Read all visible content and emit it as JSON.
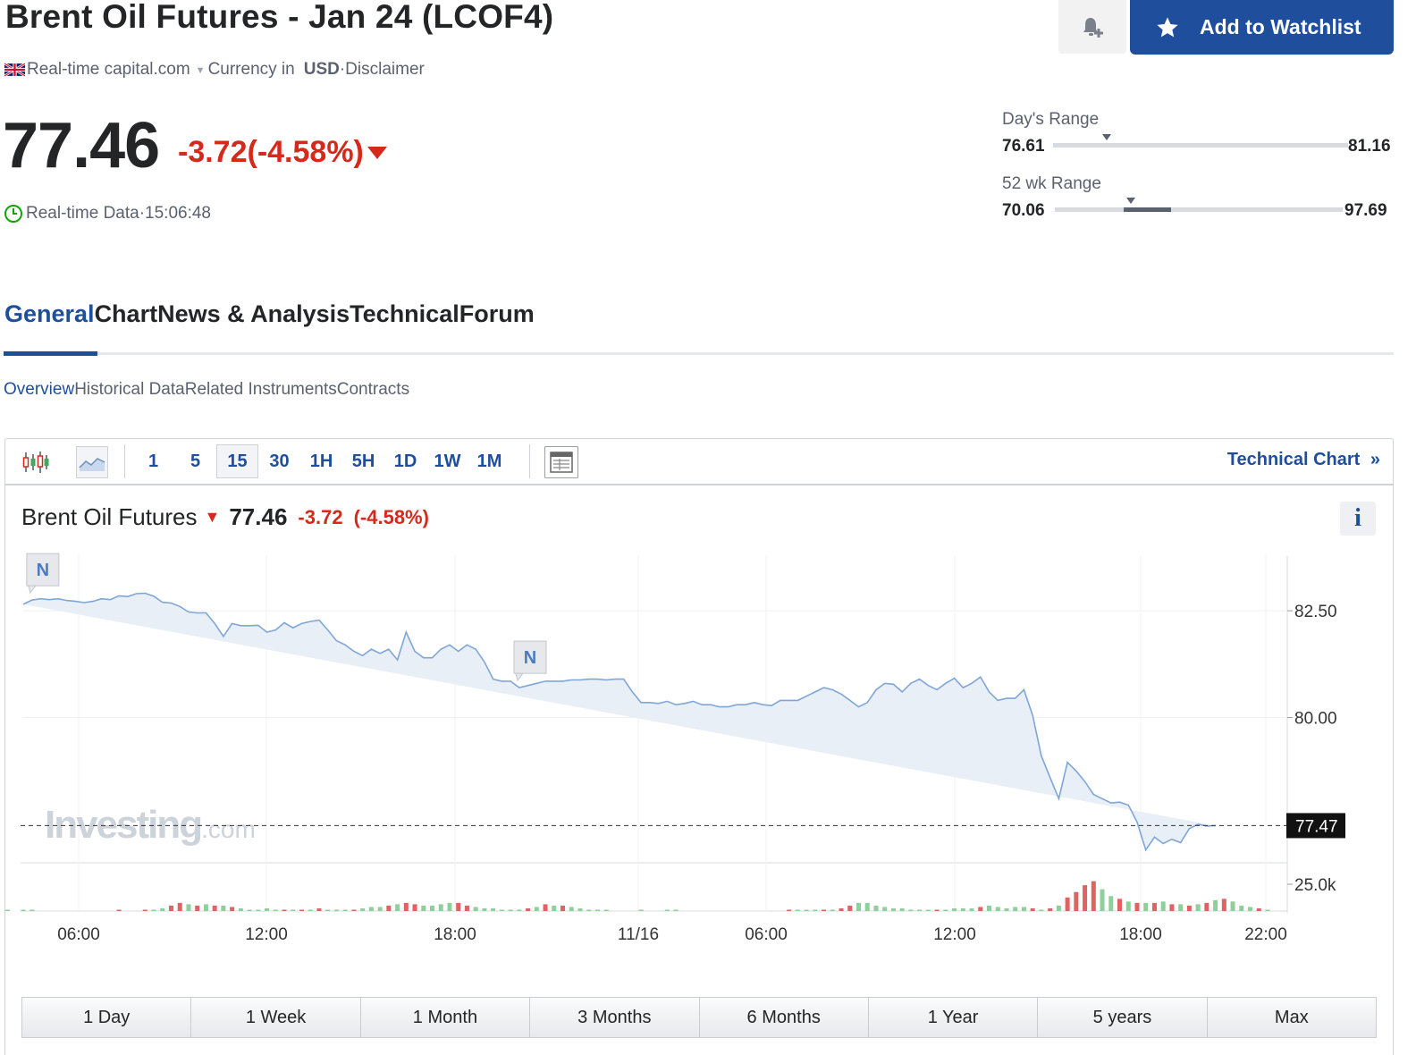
{
  "header": {
    "title": "Brent Oil Futures - Jan 24 (LCOF4)",
    "source": "Real-time capital.com",
    "currency_label": "Currency in",
    "currency": "USD",
    "disclaimer": "·Disclaimer",
    "watchlist_label": "Add to Watchlist"
  },
  "quote": {
    "price": "77.46",
    "change": "-3.72(-4.58%)",
    "realtime_label": "Real-time Data·15:06:48"
  },
  "ranges": {
    "day_label": "Day's Range",
    "day_low": "76.61",
    "day_high": "81.16",
    "wk52_label": "52 wk Range",
    "wk52_low": "70.06",
    "wk52_high": "97.69"
  },
  "tabs": [
    "General",
    "Chart",
    "News & Analysis",
    "Technical",
    "Forum"
  ],
  "subtabs": [
    "Overview",
    "Historical Data",
    "Related Instruments",
    "Contracts"
  ],
  "toolbar": {
    "intervals": [
      "1",
      "5",
      "15",
      "30",
      "1H",
      "5H",
      "1D",
      "1W",
      "1M"
    ],
    "selected_interval": "15",
    "technical_chart_label": "Technical Chart",
    "technical_chart_chevron": "»"
  },
  "chart_header": {
    "name": "Brent Oil Futures",
    "price": "77.46",
    "change": "-3.72",
    "change_pct": "(-4.58%)",
    "info": "i"
  },
  "periods": [
    "1 Day",
    "1 Week",
    "1 Month",
    "3 Months",
    "6 Months",
    "1 Year",
    "5 years",
    "Max"
  ],
  "colors": {
    "brand_blue": "#1e4e9c",
    "down_red": "#d52a1b",
    "line": "#7fa6d6",
    "area": "#e8eef7",
    "vol_up": "#8fcf9c",
    "vol_down": "#e06262"
  },
  "chart_data": {
    "type": "area",
    "watermark": "Investing.com",
    "y_ticks": [
      "82.50",
      "80.00"
    ],
    "volume_tick": "25.0k",
    "last_price_label": "77.47",
    "news_marker": "N",
    "ylim": [
      76.6,
      83.8
    ],
    "x_ticks": [
      "06:00",
      "12:00",
      "18:00",
      "11/16",
      "06:00",
      "12:00",
      "18:00",
      "22:00"
    ],
    "x": [
      0,
      2,
      4,
      6,
      8,
      10,
      12,
      14,
      16,
      18,
      20,
      22,
      24,
      26,
      28,
      30,
      32,
      34,
      36,
      38,
      40,
      42,
      44,
      46,
      48,
      50,
      52,
      54,
      56,
      58,
      60,
      62,
      64,
      66,
      68,
      70,
      72,
      74,
      76,
      78,
      80,
      82,
      84,
      86,
      88,
      90,
      92,
      94,
      96,
      98,
      100,
      102,
      104,
      106,
      108,
      110,
      112,
      114,
      116,
      118,
      120,
      122,
      124,
      126,
      128,
      130,
      132,
      134,
      136,
      138,
      140,
      142,
      144,
      146,
      148,
      150,
      152,
      154,
      156,
      158,
      160,
      162,
      164,
      166,
      168,
      170,
      172,
      174,
      176,
      178,
      180,
      182,
      184,
      186,
      188,
      190,
      192,
      194,
      196,
      198,
      200,
      202,
      204,
      206,
      208,
      210,
      212,
      214,
      216,
      218,
      220,
      222,
      224,
      226,
      228,
      230,
      232,
      234,
      236,
      238,
      240,
      242,
      244,
      246,
      248,
      250,
      252,
      254,
      256,
      258,
      260,
      262,
      264,
      266,
      268,
      270,
      272,
      274,
      276,
      278,
      280,
      282,
      284,
      286
    ],
    "values": [
      82.65,
      82.75,
      82.78,
      82.76,
      82.78,
      82.74,
      82.72,
      82.69,
      82.72,
      82.78,
      82.76,
      82.85,
      82.83,
      82.9,
      82.91,
      82.84,
      82.7,
      82.68,
      82.6,
      82.47,
      82.45,
      82.45,
      82.2,
      81.9,
      82.2,
      82.15,
      82.15,
      82.16,
      82.0,
      82.05,
      82.22,
      82.1,
      82.2,
      82.25,
      82.28,
      82.05,
      81.8,
      81.7,
      81.55,
      81.45,
      81.6,
      81.5,
      81.6,
      81.35,
      82.0,
      81.55,
      81.4,
      81.4,
      81.6,
      81.7,
      81.55,
      81.7,
      81.6,
      81.3,
      80.9,
      80.85,
      80.85,
      80.7,
      80.75,
      80.8,
      80.85,
      80.85,
      80.85,
      80.88,
      80.88,
      80.9,
      80.9,
      80.88,
      80.9,
      80.9,
      80.6,
      80.35,
      80.35,
      80.33,
      80.38,
      80.3,
      80.33,
      80.38,
      80.3,
      80.3,
      80.25,
      80.25,
      80.3,
      80.3,
      80.35,
      80.3,
      80.28,
      80.4,
      80.4,
      80.4,
      80.5,
      80.6,
      80.7,
      80.65,
      80.55,
      80.4,
      80.25,
      80.35,
      80.65,
      80.8,
      80.78,
      80.6,
      80.8,
      80.9,
      80.75,
      80.65,
      80.8,
      80.92,
      80.7,
      80.8,
      80.95,
      80.6,
      80.4,
      80.45,
      80.45,
      80.65,
      80.05,
      79.1,
      78.6,
      78.1,
      78.95,
      78.75,
      78.5,
      78.2,
      78.1,
      78.0,
      78.02,
      77.95,
      77.55,
      76.9,
      77.2,
      77.05,
      77.15,
      77.07,
      77.4,
      77.5,
      77.46,
      77.47
    ],
    "volume": [
      1,
      1,
      0,
      0,
      0,
      0,
      0,
      0,
      0,
      0,
      0,
      1,
      0,
      0,
      1,
      1,
      2,
      4,
      6,
      5,
      4,
      5,
      4,
      4,
      3,
      2,
      1,
      1,
      2,
      1,
      1,
      1,
      1,
      1,
      2,
      1,
      1,
      1,
      1,
      2,
      3,
      3,
      4,
      5,
      6,
      5,
      4,
      4,
      5,
      6,
      6,
      4,
      3,
      2,
      2,
      1,
      1,
      1,
      2,
      3,
      5,
      4,
      4,
      3,
      2,
      1,
      1,
      1,
      0,
      0,
      0,
      1,
      0,
      0,
      1,
      1,
      0,
      0,
      0,
      0,
      0,
      0,
      0,
      0,
      0,
      0,
      0,
      0,
      1,
      1,
      1,
      1,
      1,
      1,
      2,
      4,
      6,
      6,
      4,
      3,
      2,
      2,
      1,
      1,
      1,
      1,
      1,
      2,
      2,
      2,
      3,
      4,
      3,
      2,
      3,
      3,
      2,
      1,
      2,
      4,
      10,
      14,
      19,
      22,
      16,
      11,
      9,
      7,
      6,
      6,
      6,
      7,
      5,
      5,
      4,
      5,
      6,
      8,
      9,
      7,
      4,
      3,
      2,
      1,
      1,
      1
    ],
    "volume_down_idx": [
      11,
      14,
      17,
      18,
      20,
      22,
      24,
      30,
      32,
      34,
      38,
      42,
      44,
      45,
      50,
      51,
      58,
      60,
      62,
      69,
      76,
      84,
      88,
      92,
      94,
      95,
      105,
      110,
      116,
      118,
      120,
      121,
      122,
      123,
      126,
      128,
      130,
      132,
      134,
      136,
      138,
      142
    ],
    "news_x": [
      1,
      113,
      374,
      457,
      488,
      576,
      652,
      697
    ]
  }
}
